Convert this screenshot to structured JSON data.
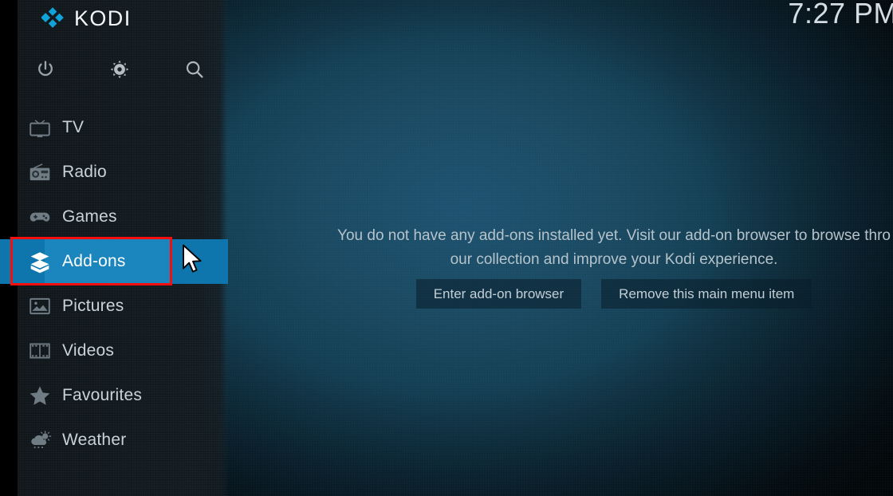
{
  "app": {
    "brand": "KODI",
    "clock": "7:27 PM"
  },
  "toolbar": {
    "buttons": [
      {
        "name": "power-icon",
        "label": "Power"
      },
      {
        "name": "gear-icon",
        "label": "Settings"
      },
      {
        "name": "search-icon",
        "label": "Search"
      }
    ]
  },
  "sidebar": {
    "items": [
      {
        "label": "TV",
        "icon": "tv-icon",
        "selected": false
      },
      {
        "label": "Radio",
        "icon": "radio-icon",
        "selected": false
      },
      {
        "label": "Games",
        "icon": "gamepad-icon",
        "selected": false
      },
      {
        "label": "Add-ons",
        "icon": "addons-box-icon",
        "selected": true
      },
      {
        "label": "Pictures",
        "icon": "pictures-icon",
        "selected": false
      },
      {
        "label": "Videos",
        "icon": "film-icon",
        "selected": false
      },
      {
        "label": "Favourites",
        "icon": "star-icon",
        "selected": false
      },
      {
        "label": "Weather",
        "icon": "weather-icon",
        "selected": false
      }
    ]
  },
  "main": {
    "message_line1": "You do not have any add-ons installed yet. Visit our add-on browser to browse thro",
    "message_line2": "our collection and improve your Kodi experience.",
    "buttons": [
      {
        "label": "Enter add-on browser"
      },
      {
        "label": "Remove this main menu item"
      }
    ]
  },
  "annotation": {
    "highlight_color": "#f60d0d",
    "target": "Add-ons"
  },
  "colors": {
    "accent": "#1b86bd",
    "selection": "#0f76ad",
    "logo_blue": "#0fa3d9",
    "sidebar_bg": "#121a1f"
  }
}
